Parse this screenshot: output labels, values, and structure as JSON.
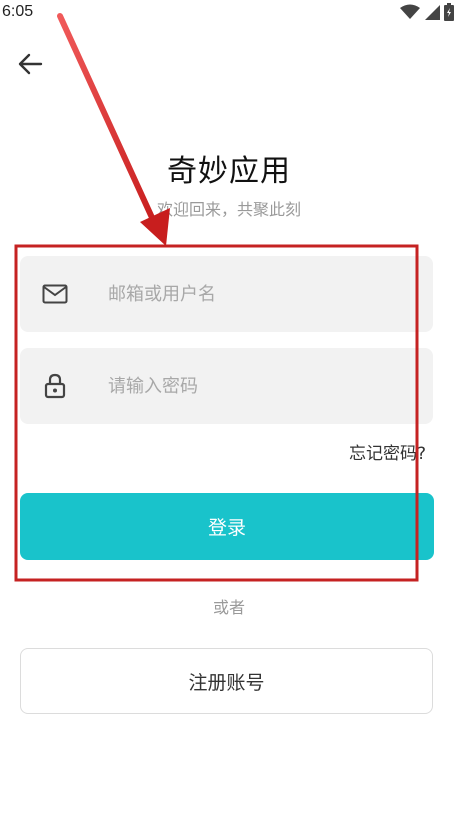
{
  "status_bar": {
    "time": "6:05",
    "icons": [
      "wifi-icon",
      "cellular-signal-icon",
      "battery-icon"
    ]
  },
  "nav": {
    "back_icon": "arrow-left-icon"
  },
  "header": {
    "title": "奇妙应用",
    "subtitle": "欢迎回来，共聚此刻"
  },
  "form": {
    "username": {
      "icon": "mail-icon",
      "placeholder": "邮箱或用户名",
      "value": ""
    },
    "password": {
      "icon": "lock-icon",
      "placeholder": "请输入密码",
      "value": ""
    },
    "forgot_label": "忘记密码?",
    "login_label": "登录"
  },
  "alt": {
    "or_label": "或者",
    "register_label": "注册账号"
  },
  "colors": {
    "accent": "#19c3cb",
    "field_bg": "#f2f2f2",
    "annotation": "#d22b2b"
  }
}
